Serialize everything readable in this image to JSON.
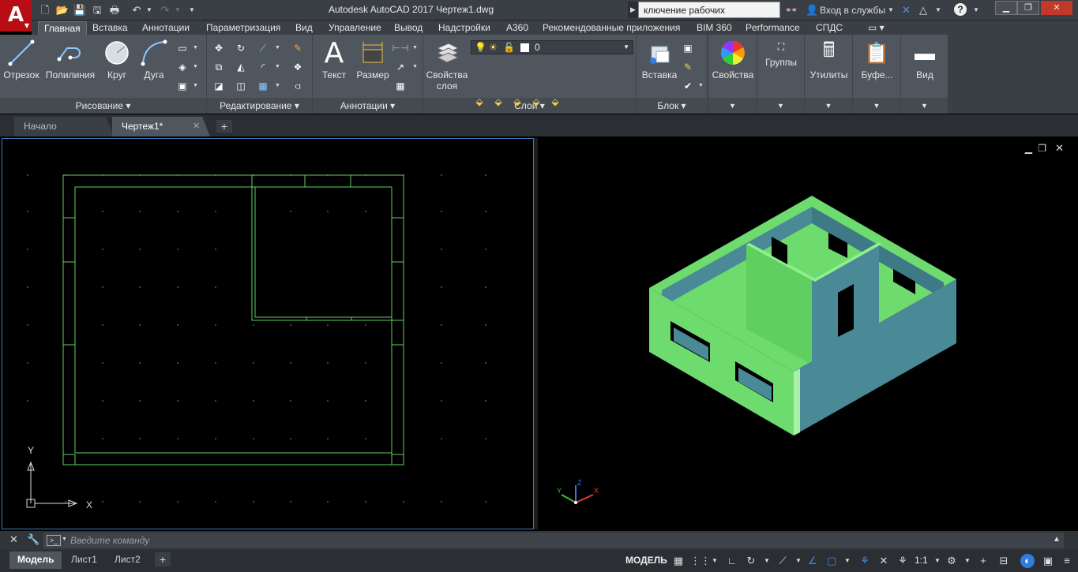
{
  "app": {
    "logo_letter": "A",
    "title": "Autodesk AutoCAD 2017    Чертеж1.dwg",
    "search_text": "ключение рабочих пространств",
    "sign_in": "Вход в службы"
  },
  "ribbon_tabs": [
    "Главная",
    "Вставка",
    "Аннотации",
    "Параметризация",
    "Вид",
    "Управление",
    "Вывод",
    "Надстройки",
    "A360",
    "Рекомендованные приложения",
    "BIM 360",
    "Performance",
    "СПДС"
  ],
  "draw_panel": {
    "title": "Рисование",
    "line": "Отрезок",
    "polyline": "Полилиния",
    "circle": "Круг",
    "arc": "Дуга"
  },
  "modify_panel": {
    "title": "Редактирование"
  },
  "annotation_panel": {
    "title": "Аннотации",
    "text": "Текст",
    "dimension": "Размер"
  },
  "layers_panel": {
    "title": "Слои",
    "layer_props_line1": "Свойства",
    "layer_props_line2": "слоя",
    "current_layer": "0"
  },
  "block_panel": {
    "title": "Блок",
    "insert": "Вставка"
  },
  "side_panels": {
    "properties": "Свойства",
    "groups": "Группы",
    "utilities": "Утилиты",
    "clipboard": "Буфе...",
    "view": "Вид"
  },
  "doc_tabs": {
    "start": "Начало",
    "drawing": "Чертеж1*"
  },
  "ucs": {
    "x": "X",
    "y": "Y",
    "z": "Z"
  },
  "command": {
    "placeholder": "Введите команду"
  },
  "layout_tabs": [
    "Модель",
    "Лист1",
    "Лист2"
  ],
  "status": {
    "model": "МОДЕЛЬ",
    "scale": "1:1"
  },
  "colors": {
    "wall_top": "#6edb6e",
    "wall_side": "#4a8a96",
    "plan_lines": "#5fd15f",
    "accent_red": "#b80d14"
  }
}
